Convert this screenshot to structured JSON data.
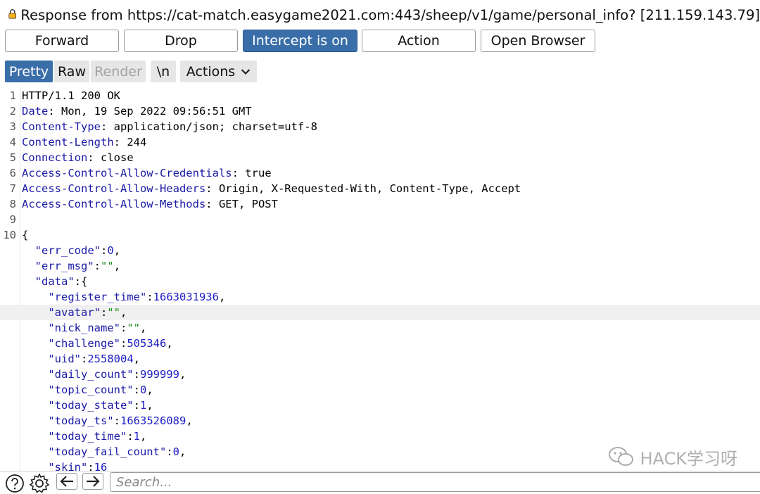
{
  "title": "Response from https://cat-match.easygame2021.com:443/sheep/v1/game/personal_info?  [211.159.143.79]",
  "buttons": {
    "forward": "Forward",
    "drop": "Drop",
    "intercept": "Intercept is on",
    "action": "Action",
    "open_browser": "Open Browser"
  },
  "tabs": {
    "pretty": "Pretty",
    "raw": "Raw",
    "render": "Render",
    "newline": "\\n",
    "actions": "Actions"
  },
  "headers": [
    {
      "n": "1",
      "name": "HTTP/1.1 200 OK",
      "value": ""
    },
    {
      "n": "2",
      "name": "Date",
      "value": ": Mon, 19 Sep 2022 09:56:51 GMT"
    },
    {
      "n": "3",
      "name": "Content-Type",
      "value": ": application/json; charset=utf-8"
    },
    {
      "n": "4",
      "name": "Content-Length",
      "value": ": 244"
    },
    {
      "n": "5",
      "name": "Connection",
      "value": ": close"
    },
    {
      "n": "6",
      "name": "Access-Control-Allow-Credentials",
      "value": ": true"
    },
    {
      "n": "7",
      "name": "Access-Control-Allow-Headers",
      "value": ": Origin, X-Requested-With, Content-Type, Accept"
    },
    {
      "n": "8",
      "name": "Access-Control-Allow-Methods",
      "value": ": GET, POST"
    },
    {
      "n": "9",
      "name": "",
      "value": ""
    },
    {
      "n": "10",
      "name": "",
      "value": "{"
    }
  ],
  "body_lines": [
    {
      "indent": "  ",
      "key": "\"err_code\"",
      "sep": ":",
      "val": "0",
      "vtype": "num",
      "end": ","
    },
    {
      "indent": "  ",
      "key": "\"err_msg\"",
      "sep": ":",
      "val": "\"\"",
      "vtype": "str",
      "end": ","
    },
    {
      "indent": "  ",
      "key": "\"data\"",
      "sep": ":",
      "val": "{",
      "vtype": "punct",
      "end": ""
    },
    {
      "indent": "    ",
      "key": "\"register_time\"",
      "sep": ":",
      "val": "1663031936",
      "vtype": "num",
      "end": ","
    },
    {
      "indent": "    ",
      "key": "\"avatar\"",
      "sep": ":",
      "val": "\"\"",
      "vtype": "str",
      "end": ",",
      "highlight": true
    },
    {
      "indent": "    ",
      "key": "\"nick_name\"",
      "sep": ":",
      "val": "\"\"",
      "vtype": "str",
      "end": ","
    },
    {
      "indent": "    ",
      "key": "\"challenge\"",
      "sep": ":",
      "val": "505346",
      "vtype": "num",
      "end": ","
    },
    {
      "indent": "    ",
      "key": "\"uid\"",
      "sep": ":",
      "val": "2558004",
      "vtype": "num",
      "end": ","
    },
    {
      "indent": "    ",
      "key": "\"daily_count\"",
      "sep": ":",
      "val": "999999",
      "vtype": "num",
      "end": ","
    },
    {
      "indent": "    ",
      "key": "\"topic_count\"",
      "sep": ":",
      "val": "0",
      "vtype": "num",
      "end": ","
    },
    {
      "indent": "    ",
      "key": "\"today_state\"",
      "sep": ":",
      "val": "1",
      "vtype": "num",
      "end": ","
    },
    {
      "indent": "    ",
      "key": "\"today_ts\"",
      "sep": ":",
      "val": "1663526089",
      "vtype": "num",
      "end": ","
    },
    {
      "indent": "    ",
      "key": "\"today_time\"",
      "sep": ":",
      "val": "1",
      "vtype": "num",
      "end": ","
    },
    {
      "indent": "    ",
      "key": "\"today_fail_count\"",
      "sep": ":",
      "val": "0",
      "vtype": "num",
      "end": ","
    },
    {
      "indent": "    ",
      "key": "\"skin\"",
      "sep": ":",
      "val": "16",
      "vtype": "num",
      "end": ""
    }
  ],
  "search": {
    "placeholder": "Search..."
  },
  "watermark": "HACK学习呀",
  "icons": [
    "lock-icon",
    "help-icon",
    "settings-icon",
    "back-arrow-icon",
    "forward-arrow-icon",
    "chevron-down-icon",
    "wechat-icon"
  ],
  "colors": {
    "accent": "#3a6ea8",
    "header_name": "#1a1aa6",
    "number": "#1c1cc4",
    "string": "#1a8c1a"
  }
}
